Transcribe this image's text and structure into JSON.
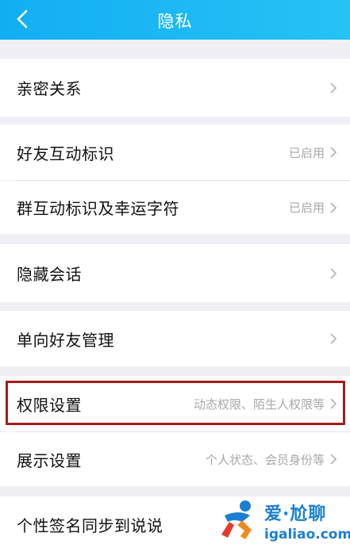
{
  "header": {
    "title": "隐私",
    "back_icon": "chevron-left-icon",
    "bg_color": "#1bb6f4"
  },
  "rows": [
    {
      "label": "亲密关系",
      "value": ""
    },
    {
      "label": "好友互动标识",
      "value": "已启用"
    },
    {
      "label": "群互动标识及幸运字符",
      "value": "已启用"
    },
    {
      "label": "隐藏会话",
      "value": ""
    },
    {
      "label": "单向好友管理",
      "value": ""
    },
    {
      "label": "权限设置",
      "value": "动态权限、陌生人权限等"
    },
    {
      "label": "展示设置",
      "value": "个人状态、会员身份等"
    },
    {
      "label": "个性签名同步到说说",
      "value": ""
    }
  ],
  "highlight_color": "#a51919",
  "watermark": {
    "title": "爱·尬聊",
    "site": "igaliao.com"
  }
}
